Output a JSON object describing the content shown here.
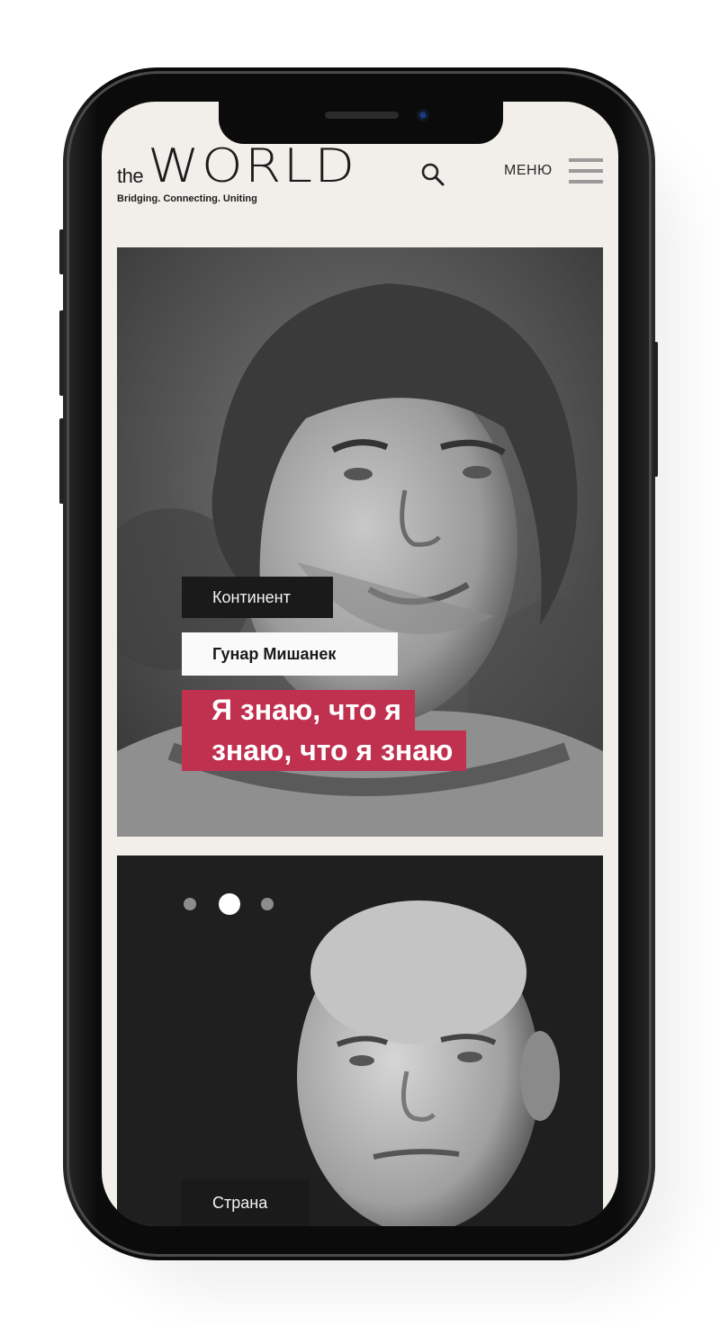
{
  "header": {
    "logo_prefix": "the",
    "logo_word": "WORLD",
    "tagline": "Bridging. Connecting. Uniting",
    "menu_label": "МЕНЮ"
  },
  "cards": [
    {
      "category": "Континент",
      "person": "Гунар Мишанек",
      "headline_line1": "Я знаю, что я",
      "headline_line2": "знаю, что я знаю"
    },
    {
      "category": "Страна"
    }
  ],
  "carousel": {
    "dot_count": 3,
    "active_index": 1
  },
  "colors": {
    "accent": "#c0304f",
    "page_bg": "#f2efea",
    "dark_tag": "#1a1a1a"
  },
  "icons": {
    "search": "search-icon",
    "menu": "hamburger-icon"
  }
}
